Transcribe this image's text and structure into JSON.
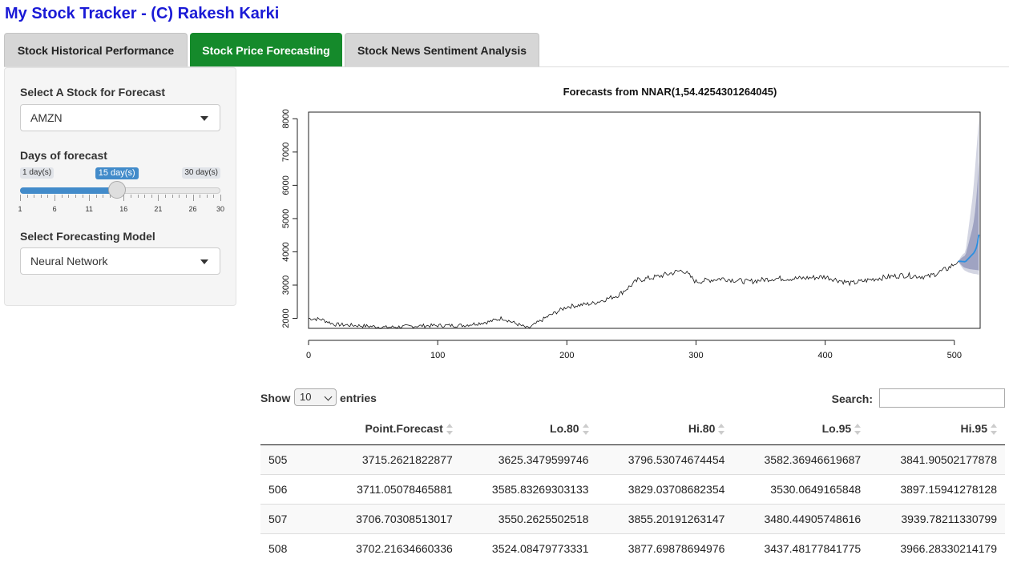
{
  "app": {
    "title": "My Stock Tracker - (C) Rakesh Karki"
  },
  "tabs": [
    {
      "label": "Stock Historical Performance",
      "active": false
    },
    {
      "label": "Stock Price Forecasting",
      "active": true
    },
    {
      "label": "Stock News Sentiment Analysis",
      "active": false
    }
  ],
  "sidebar": {
    "stock_label": "Select A Stock for Forecast",
    "stock_value": "AMZN",
    "days_label": "Days of forecast",
    "slider": {
      "min": 1,
      "max": 30,
      "value": 15,
      "min_label": "1 day(s)",
      "max_label": "30 day(s)",
      "value_label": "15 day(s)",
      "tick_labels": [
        "1",
        "6",
        "11",
        "16",
        "21",
        "26",
        "30"
      ]
    },
    "model_label": "Select Forecasting Model",
    "model_value": "Neural Network"
  },
  "chart_data": {
    "type": "line",
    "title": "Forecasts from NNAR(1,54.4254301264045)",
    "xlim": [
      0,
      520
    ],
    "ylim": [
      1700,
      8200
    ],
    "x_ticks": [
      0,
      100,
      200,
      300,
      400,
      500
    ],
    "y_ticks": [
      2000,
      3000,
      4000,
      5000,
      6000,
      7000,
      8000
    ],
    "history_anchors": [
      [
        0,
        2000
      ],
      [
        10,
        1970
      ],
      [
        20,
        1820
      ],
      [
        40,
        1780
      ],
      [
        60,
        1730
      ],
      [
        90,
        1780
      ],
      [
        120,
        1790
      ],
      [
        140,
        1900
      ],
      [
        150,
        2010
      ],
      [
        160,
        1850
      ],
      [
        170,
        1700
      ],
      [
        185,
        2050
      ],
      [
        200,
        2350
      ],
      [
        220,
        2450
      ],
      [
        240,
        2700
      ],
      [
        255,
        3150
      ],
      [
        270,
        3250
      ],
      [
        290,
        3450
      ],
      [
        300,
        3100
      ],
      [
        320,
        3200
      ],
      [
        340,
        3100
      ],
      [
        360,
        3200
      ],
      [
        380,
        3200
      ],
      [
        400,
        3250
      ],
      [
        420,
        3050
      ],
      [
        440,
        3200
      ],
      [
        460,
        3300
      ],
      [
        480,
        3250
      ],
      [
        495,
        3500
      ],
      [
        503,
        3715
      ]
    ],
    "forecast": {
      "x": [
        505,
        506,
        507,
        508,
        509,
        510,
        511,
        512,
        513,
        514,
        515,
        516,
        517,
        518,
        519
      ],
      "point": [
        3715,
        3711,
        3707,
        3702,
        3720,
        3760,
        3800,
        3840,
        3880,
        3920,
        3960,
        4030,
        4120,
        4280,
        4520
      ],
      "lo80": [
        3625,
        3586,
        3550,
        3524,
        3510,
        3500,
        3490,
        3480,
        3475,
        3470,
        3465,
        3460,
        3455,
        3450,
        3440
      ],
      "hi80": [
        3797,
        3829,
        3855,
        3878,
        3950,
        4100,
        4250,
        4400,
        4550,
        4700,
        4900,
        5200,
        5600,
        6100,
        6700
      ],
      "lo95": [
        3582,
        3530,
        3480,
        3437,
        3420,
        3400,
        3380,
        3370,
        3360,
        3350,
        3340,
        3335,
        3330,
        3320,
        3310
      ],
      "hi95": [
        3842,
        3897,
        3940,
        3966,
        4100,
        4400,
        4700,
        5000,
        5300,
        5600,
        6000,
        6500,
        7000,
        7500,
        8000
      ]
    }
  },
  "table": {
    "show_label": "Show",
    "length_value": "10",
    "entries_label": "entries",
    "search_label": "Search:",
    "columns": [
      "",
      "Point.Forecast",
      "Lo.80",
      "Hi.80",
      "Lo.95",
      "Hi.95"
    ],
    "rows": [
      [
        "505",
        "3715.2621822877",
        "3625.3479599746",
        "3796.53074674454",
        "3582.36946619687",
        "3841.90502177878"
      ],
      [
        "506",
        "3711.05078465881",
        "3585.83269303133",
        "3829.03708682354",
        "3530.0649165848",
        "3897.15941278128"
      ],
      [
        "507",
        "3706.70308513017",
        "3550.2625502518",
        "3855.20191263147",
        "3480.44905748616",
        "3939.78211330799"
      ],
      [
        "508",
        "3702.21634660336",
        "3524.08479773331",
        "3877.69878694976",
        "3437.48177841775",
        "3966.28330214179"
      ]
    ]
  },
  "colors": {
    "title_blue": "#1a1ad6",
    "tab_active": "#158a2b",
    "slider_blue": "#428bca",
    "forecast_line": "#2b8fe0",
    "band80": "#9fa3c2",
    "band95": "#d3d5e2"
  }
}
